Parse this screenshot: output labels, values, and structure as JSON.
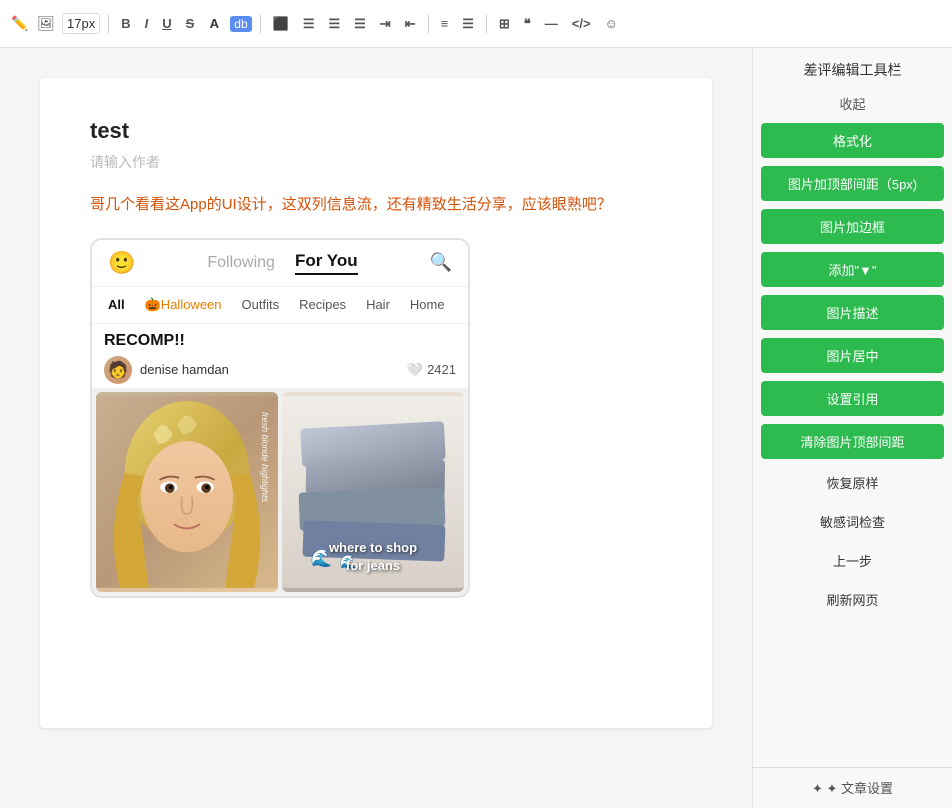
{
  "toolbar": {
    "font_size": "17px",
    "bold": "B",
    "italic": "I",
    "underline": "U",
    "strikethrough": "S",
    "font_color": "A",
    "highlight": "db",
    "align_left": "≡",
    "align_center": "≡",
    "align_right": "≡",
    "indent": "⇥",
    "outdent": "⇤",
    "list_ul": "≡",
    "list_ol": "≡",
    "table": "⊞",
    "quote": "❝",
    "hr": "—",
    "code": "</>",
    "emoji": "☺"
  },
  "editor": {
    "title": "test",
    "author_placeholder": "请输入作者",
    "body_text": "哥几个看看这App的UI设计，这双列信息流，还有精致生活分享，应该眼熟吧？"
  },
  "app": {
    "tab_following": "Following",
    "tab_for_you": "For You",
    "categories": [
      "All",
      "🎃Halloween",
      "Outfits",
      "Recipes",
      "Hair",
      "Home"
    ],
    "active_tab": "For You",
    "active_category": "All",
    "post_title": "RECOMP!!",
    "username": "denise hamdan",
    "like_count": "2421",
    "img_left_label": "fresh blonde highlights",
    "img_right_label1": "where to shop",
    "img_right_label2": "for jeans"
  },
  "right_panel": {
    "title": "差评编辑工具栏",
    "collapse": "收起",
    "buttons": [
      "格式化",
      "图片加顶部间距（5px)",
      "图片加边框",
      "添加\"▼\"",
      "图片描述",
      "图片居中",
      "设置引用",
      "清除图片顶部间距",
      "恢复原样",
      "敏感词检查",
      "上一步",
      "刷新网页"
    ],
    "article_settings": "✦ 文章设置"
  }
}
